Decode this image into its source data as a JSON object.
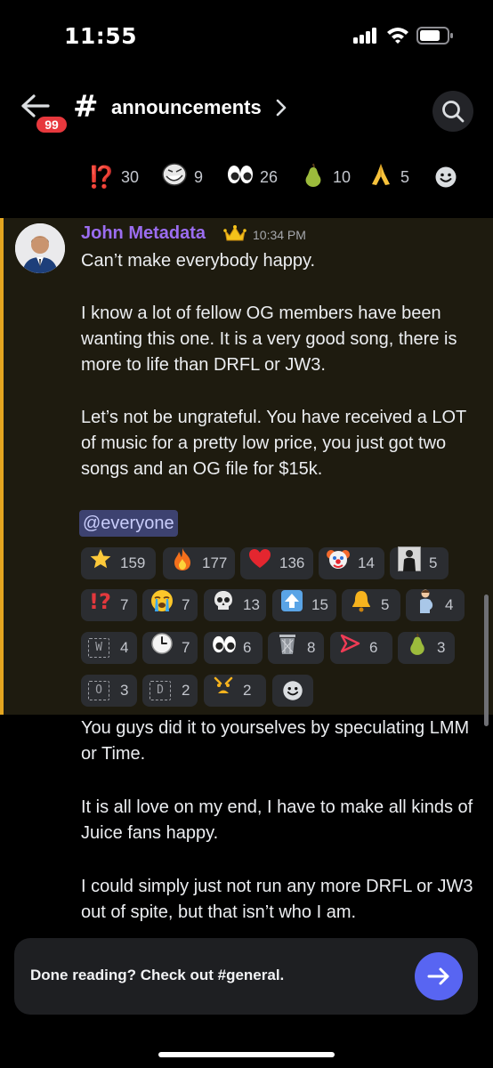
{
  "status_bar": {
    "time": "11:55"
  },
  "header": {
    "unread_count": "99",
    "hash": "#",
    "channel_name": "announcements"
  },
  "top_reactions": [
    {
      "emoji": "⁉️",
      "count": "30",
      "icon": "interrobang-icon"
    },
    {
      "emoji": "🧌",
      "count": "9",
      "icon": "trollface-icon"
    },
    {
      "emoji": "👀",
      "count": "26",
      "icon": "eyes-icon"
    },
    {
      "emoji": "🍐",
      "count": "10",
      "icon": "pear-icon"
    },
    {
      "emoji": "🙏",
      "count": "5",
      "icon": "pray-icon"
    }
  ],
  "message": {
    "author": "John Metadata",
    "author_color": "#9b6df0",
    "timestamp": "10:34 PM",
    "paragraphs": [
      "Can’t make everybody happy.",
      "I know a lot of fellow OG members have been wanting this one. It is a very good song, there is more to life than DRFL or JW3.",
      "Let’s not be ungrateful. You have received a LOT of music for a pretty low price, you just got two songs and an OG file for $15k."
    ],
    "mention": "@everyone",
    "reactions": [
      {
        "emoji": "⭐",
        "count": "159",
        "icon": "star-icon"
      },
      {
        "emoji": "🔥",
        "count": "177",
        "icon": "fire-icon"
      },
      {
        "emoji": "❤️",
        "count": "136",
        "icon": "heart-icon"
      },
      {
        "emoji": "🤡",
        "count": "14",
        "icon": "clown-icon"
      },
      {
        "emoji": "",
        "count": "5",
        "icon": "custom-person-emoji-icon"
      },
      {
        "emoji": "⁉️",
        "count": "7",
        "icon": "interrobang-icon"
      },
      {
        "emoji": "😭",
        "count": "7",
        "icon": "sob-icon"
      },
      {
        "emoji": "💀",
        "count": "13",
        "icon": "skull-icon"
      },
      {
        "emoji": "⬆️",
        "count": "15",
        "icon": "arrow-up-icon"
      },
      {
        "emoji": "🔔",
        "count": "5",
        "icon": "bell-icon"
      },
      {
        "emoji": "🤰",
        "count": "4",
        "icon": "pregnant-man-icon"
      },
      {
        "emoji": "W",
        "count": "4",
        "icon": "letter-w-icon"
      },
      {
        "emoji": "🕐",
        "count": "7",
        "icon": "clock-icon"
      },
      {
        "emoji": "👀",
        "count": "6",
        "icon": "eyes-icon"
      },
      {
        "emoji": "🗑️",
        "count": "8",
        "icon": "wastebasket-icon"
      },
      {
        "emoji": "▷",
        "count": "6",
        "icon": "play-arrow-icon"
      },
      {
        "emoji": "🍐",
        "count": "3",
        "icon": "pear-icon"
      },
      {
        "emoji": "O",
        "count": "3",
        "icon": "letter-o-icon"
      },
      {
        "emoji": "D",
        "count": "2",
        "icon": "letter-d-icon"
      },
      {
        "emoji": "😤",
        "count": "2",
        "icon": "angry-face-icon"
      }
    ]
  },
  "continuation": [
    "You guys did it to yourselves by speculating LMM or Time.",
    "It is all love on my end, I have to make all kinds of Juice fans happy.",
    "I could simply just not run any more DRFL or JW3 out of spite, but that isn’t who I am."
  ],
  "banner": {
    "text": "Done reading? Check out #general."
  },
  "colors": {
    "accent": "#5865f2",
    "highlight_border": "#e3a520",
    "badge": "#e7383d"
  }
}
